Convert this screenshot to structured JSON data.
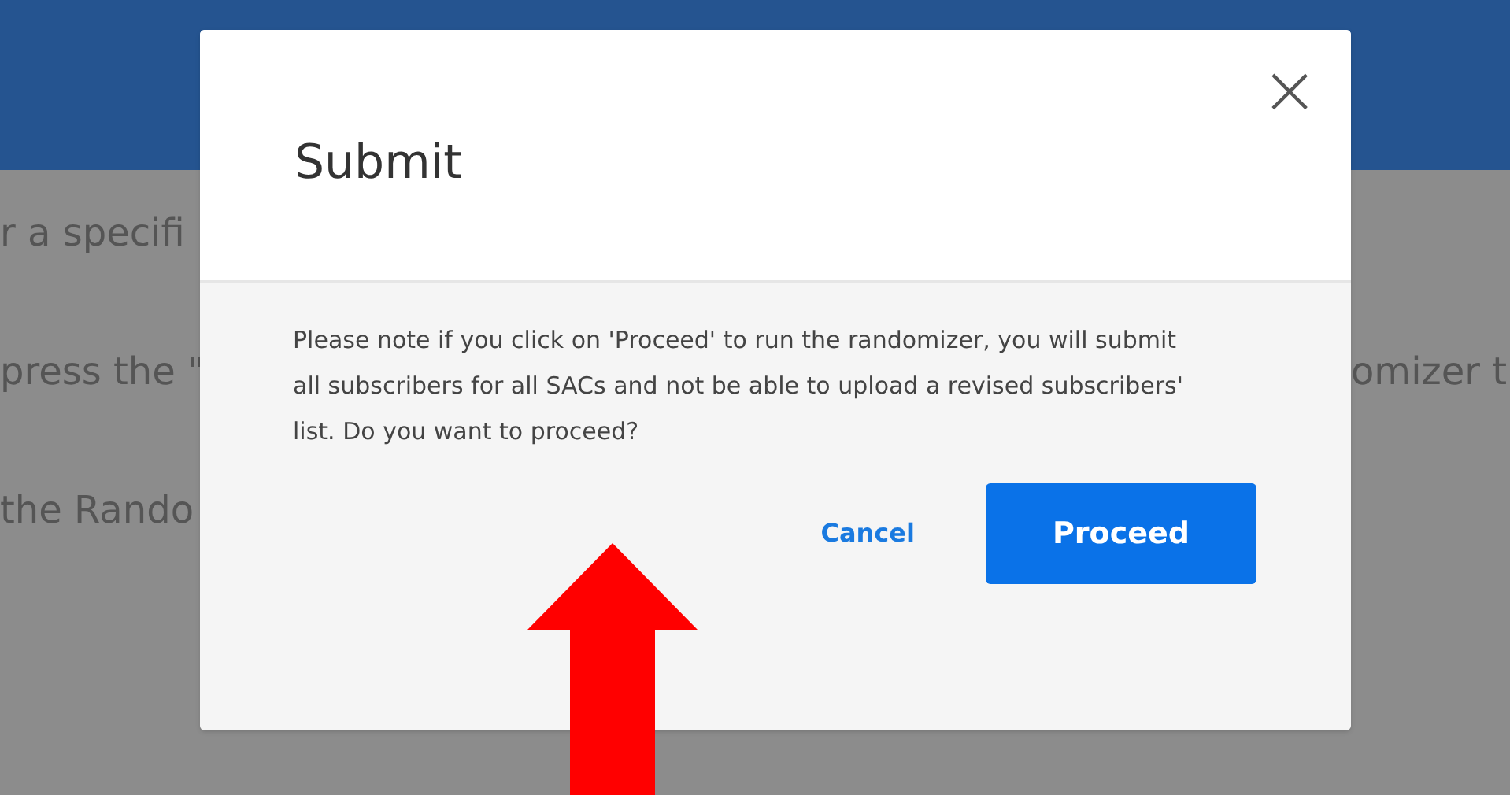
{
  "background": {
    "left_lines": [
      "r a specifi",
      "press the \"",
      "the Rando"
    ],
    "right_lines": [
      "omizer t"
    ]
  },
  "dialog": {
    "title": "Submit",
    "close": "×",
    "message": "Please note if you click on 'Proceed' to run the randomizer, you will submit all subscribers for all SACs and not be able to upload a revised subscribers' list. Do you want to proceed?",
    "buttons": [
      {
        "label": "Cancel",
        "kind": "link"
      },
      {
        "label": "Proceed",
        "kind": "primary"
      }
    ]
  },
  "annotation": {
    "kind": "arrow"
  }
}
